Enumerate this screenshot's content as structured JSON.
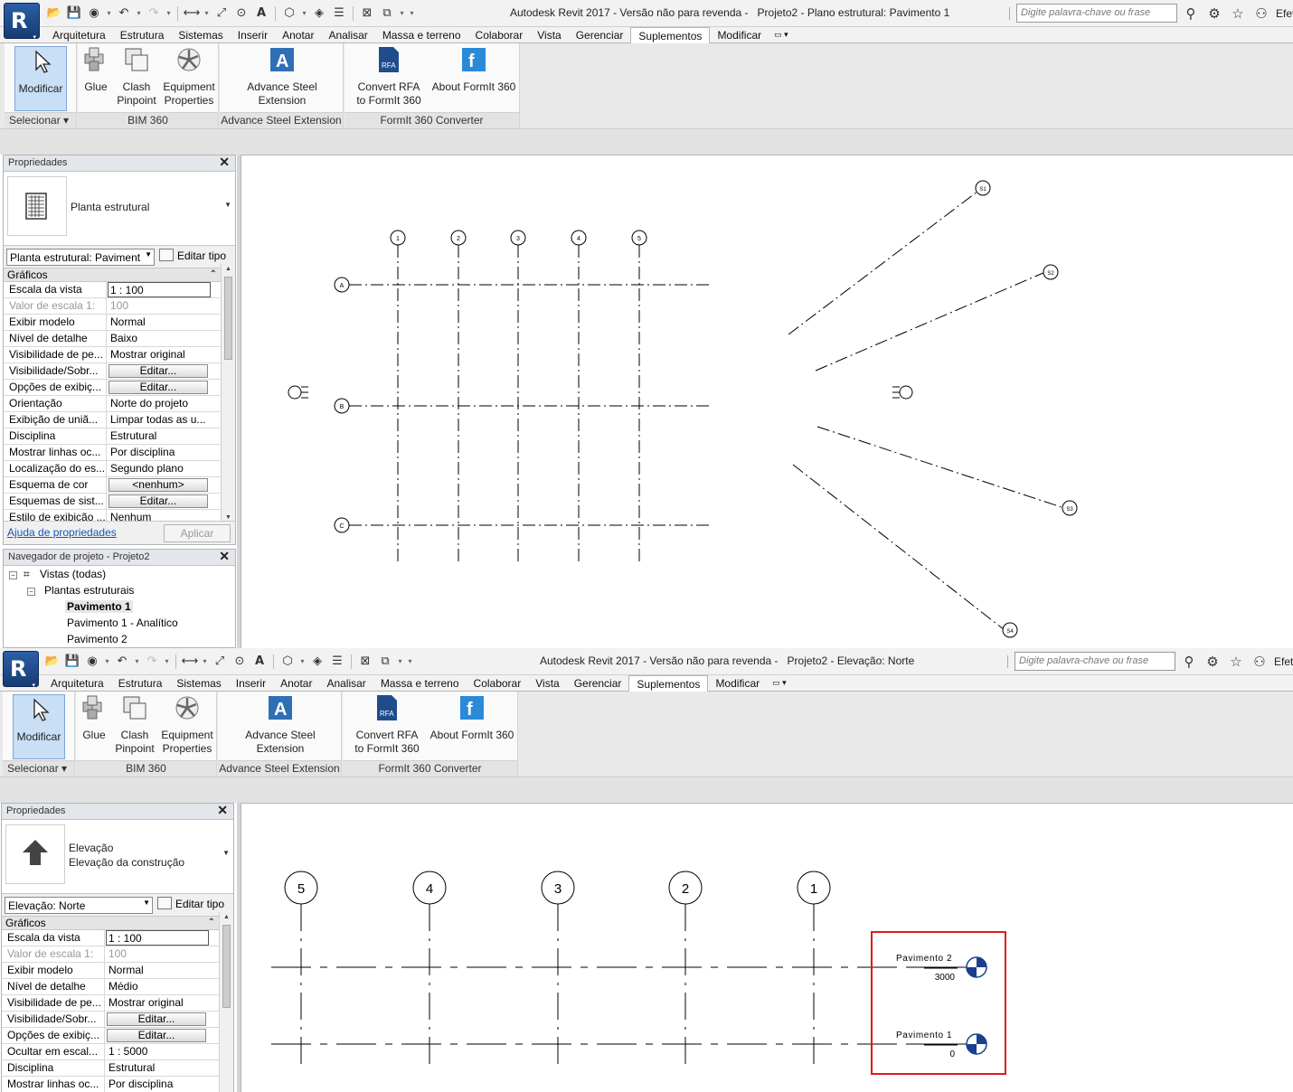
{
  "window_top": {
    "title": "Autodesk Revit 2017 - Versão não para revenda -",
    "project": "Projeto2 - Plano estrutural: Pavimento 1",
    "search_placeholder": "Digite palavra-chave ou frase",
    "signin": "Efetua"
  },
  "window_bottom": {
    "title": "Autodesk Revit 2017 - Versão não para revenda -",
    "project": "Projeto2 - Elevação: Norte",
    "search_placeholder": "Digite palavra-chave ou frase",
    "signin": "Efetua"
  },
  "tabs": [
    "Arquitetura",
    "Estrutura",
    "Sistemas",
    "Inserir",
    "Anotar",
    "Analisar",
    "Massa e terreno",
    "Colaborar",
    "Vista",
    "Gerenciar",
    "Suplementos",
    "Modificar"
  ],
  "active_tab": "Suplementos",
  "ribbon": {
    "modify": "Modificar",
    "select": "Selecionar",
    "glue": "Glue",
    "clash_1": "Clash",
    "clash_2": "Pinpoint",
    "equip_1": "Equipment",
    "equip_2": "Properties",
    "bim360": "BIM 360",
    "adv_1": "Advance Steel",
    "adv_2": "Extension",
    "adv_panel": "Advance Steel Extension",
    "conv_1": "Convert RFA",
    "conv_2": "to FormIt 360",
    "about": "About FormIt 360",
    "formit_panel": "FormIt 360 Converter"
  },
  "props_top": {
    "header": "Propriedades",
    "type_name": "Planta estrutural",
    "instance": "Planta estrutural: Paviment",
    "edit_type": "Editar tipo",
    "group": "Gráficos",
    "rows": [
      {
        "k": "Escala da vista",
        "v": "1 : 100"
      },
      {
        "k": "Valor de escala    1:",
        "v": "100"
      },
      {
        "k": "Exibir modelo",
        "v": "Normal"
      },
      {
        "k": "Nível de detalhe",
        "v": "Baixo"
      },
      {
        "k": "Visibilidade de pe...",
        "v": "Mostrar original"
      },
      {
        "k": "Visibilidade/Sobr...",
        "v": "Editar..."
      },
      {
        "k": "Opções de exibiç...",
        "v": "Editar..."
      },
      {
        "k": "Orientação",
        "v": "Norte do projeto"
      },
      {
        "k": "Exibição de uniã...",
        "v": "Limpar todas as u..."
      },
      {
        "k": "Disciplina",
        "v": "Estrutural"
      },
      {
        "k": "Mostrar linhas oc...",
        "v": "Por disciplina"
      },
      {
        "k": "Localização do es...",
        "v": "Segundo plano"
      },
      {
        "k": "Esquema de cor",
        "v": "<nenhum>"
      },
      {
        "k": "Esquemas de sist...",
        "v": "Editar..."
      },
      {
        "k": "Estilo de exibição ...",
        "v": "Nenhum"
      }
    ],
    "help": "Ajuda de propriedades",
    "apply": "Aplicar"
  },
  "navigator": {
    "header": "Navegador de projeto - Projeto2",
    "root": "Vistas (todas)",
    "group": "Plantas estruturais",
    "items": [
      "Pavimento 1",
      "Pavimento 1 - Analítico",
      "Pavimento 2"
    ]
  },
  "props_bottom": {
    "header": "Propriedades",
    "type_name": "Elevação",
    "type_sub": "Elevação da construção",
    "instance": "Elevação: Norte",
    "edit_type": "Editar tipo",
    "group": "Gráficos",
    "rows": [
      {
        "k": "Escala da vista",
        "v": "1 : 100"
      },
      {
        "k": "Valor de escala    1:",
        "v": "100"
      },
      {
        "k": "Exibir modelo",
        "v": "Normal"
      },
      {
        "k": "Nível de detalhe",
        "v": "Médio"
      },
      {
        "k": "Visibilidade de pe...",
        "v": "Mostrar original"
      },
      {
        "k": "Visibilidade/Sobr...",
        "v": "Editar..."
      },
      {
        "k": "Opções de exibiç...",
        "v": "Editar..."
      },
      {
        "k": "Ocultar em escal...",
        "v": "1 : 5000"
      },
      {
        "k": "Disciplina",
        "v": "Estrutural"
      },
      {
        "k": "Mostrar linhas oc...",
        "v": "Por disciplina"
      }
    ]
  },
  "plan": {
    "grid_v": [
      "1",
      "2",
      "3",
      "4",
      "5"
    ],
    "grid_h": [
      "A",
      "B",
      "C"
    ],
    "sections": [
      "S1",
      "S2",
      "S3",
      "S4"
    ]
  },
  "elevation": {
    "grids": [
      "5",
      "4",
      "3",
      "2",
      "1"
    ],
    "levels": [
      {
        "name": "Pavimento 2",
        "value": "3000"
      },
      {
        "name": "Pavimento 1",
        "value": "0"
      }
    ]
  }
}
